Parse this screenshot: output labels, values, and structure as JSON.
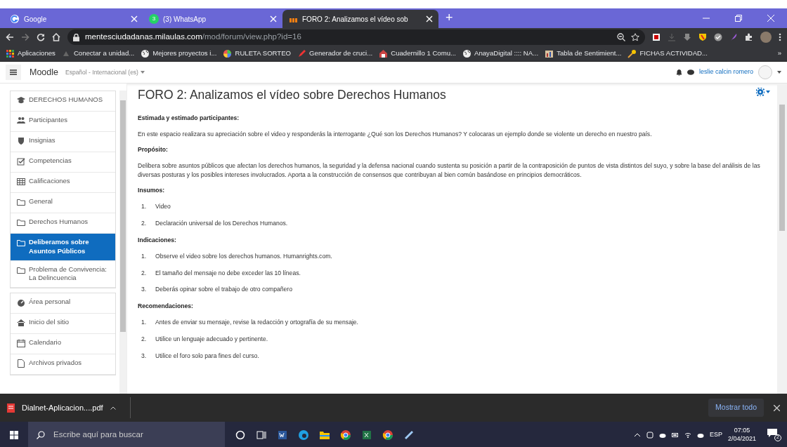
{
  "browser": {
    "tabs": [
      {
        "label": "Google",
        "selected": false
      },
      {
        "label": "(3) WhatsApp",
        "badge": "3",
        "selected": false
      },
      {
        "label": "FORO 2: Analizamos el vídeo sob",
        "selected": true
      }
    ],
    "new_tab": "+",
    "address": {
      "domain": "mentesciudadanas.milaulas.com",
      "path": "/mod/forum/view.php?id=16"
    },
    "bookmarks": [
      "Aplicaciones",
      "Conectar a unidad...",
      "Mejores proyectos i...",
      "RULETA SORTEO",
      "Generador de cruci...",
      "Cuadernillo 1 Comu...",
      "AnayaDigital :::: NA...",
      "Tabla de Sentimient...",
      "FICHAS ACTIVIDAD..."
    ],
    "bookmarks_more": "»"
  },
  "navbar": {
    "brand": "Moodle",
    "language": "Español - Internacional (es)",
    "user": "leslie calcin romero"
  },
  "sidebar": {
    "groups": [
      [
        {
          "label": "DERECHOS HUMANOS",
          "selected": false
        },
        {
          "label": "Participantes",
          "selected": false
        },
        {
          "label": "Insignias",
          "selected": false
        },
        {
          "label": "Competencias",
          "selected": false
        },
        {
          "label": "Calificaciones",
          "selected": false
        },
        {
          "label": "General",
          "selected": false
        },
        {
          "label": "Derechos Humanos",
          "selected": false
        },
        {
          "label": "Deliberamos sobre Asuntos Públicos",
          "selected": true
        },
        {
          "label": "Problema de Convivencia: La Delincuencia",
          "selected": false
        }
      ],
      [
        {
          "label": "Área personal",
          "selected": false
        },
        {
          "label": "Inicio del sitio",
          "selected": false
        },
        {
          "label": "Calendario",
          "selected": false
        },
        {
          "label": "Archivos privados",
          "selected": false
        }
      ]
    ]
  },
  "content": {
    "title": "FORO 2: Analizamos el vídeo sobre Derechos Humanos",
    "blocks": [
      {
        "kind": "heading",
        "text": "Estimada y estimado participantes:"
      },
      {
        "kind": "paragraph",
        "text": "En este espacio realizara su apreciación sobre el video y responderás la interrogante ¿Qué son los Derechos Humanos? Y colocaras un ejemplo donde se violente un derecho en nuestro país."
      },
      {
        "kind": "heading",
        "text": "Propósito:"
      },
      {
        "kind": "paragraph",
        "text": "Delibera sobre asuntos públicos que afectan los derechos humanos, la seguridad y la defensa nacional cuando sustenta su posición a partir de la contraposición de puntos de vista distintos del suyo, y sobre la base del análisis de las diversas posturas y los posibles intereses involucrados. Aporta a la construcción de consensos que contribuyan al bien común basándose en principios democráticos."
      },
      {
        "kind": "heading",
        "text": "Insumos:"
      },
      {
        "kind": "list",
        "items": [
          {
            "number": "1.",
            "text": "Video"
          },
          {
            "number": "2.",
            "text": "Declaración universal de los Derechos Humanos."
          }
        ]
      },
      {
        "kind": "heading",
        "text": "Indicaciones:"
      },
      {
        "kind": "list",
        "items": [
          {
            "number": "1.",
            "text": "Observe el video sobre los derechos humanos. Humanrights.com."
          },
          {
            "number": "2.",
            "text": "El tamaño del mensaje no debe exceder las 10 líneas."
          },
          {
            "number": "3.",
            "text": "Deberás opinar sobre el trabajo de otro compañero"
          }
        ]
      },
      {
        "kind": "heading",
        "text": "Recomendaciones:"
      },
      {
        "kind": "list",
        "items": [
          {
            "number": "1.",
            "text": "Antes de enviar su mensaje, revise la redacción y ortografía de su mensaje."
          },
          {
            "number": "2.",
            "text": "Utilice un lenguaje adecuado y pertinente."
          },
          {
            "number": "3.",
            "text": "Utilice el foro solo para fines del curso."
          }
        ]
      }
    ]
  },
  "download_bar": {
    "file": "Dialnet-Aplicacion....pdf",
    "show_all": "Mostrar todo"
  },
  "taskbar": {
    "search_placeholder": "Escribe aquí para buscar",
    "language": "ESP",
    "time": "07:05",
    "date": "2/04/2021",
    "notifications": "2"
  }
}
